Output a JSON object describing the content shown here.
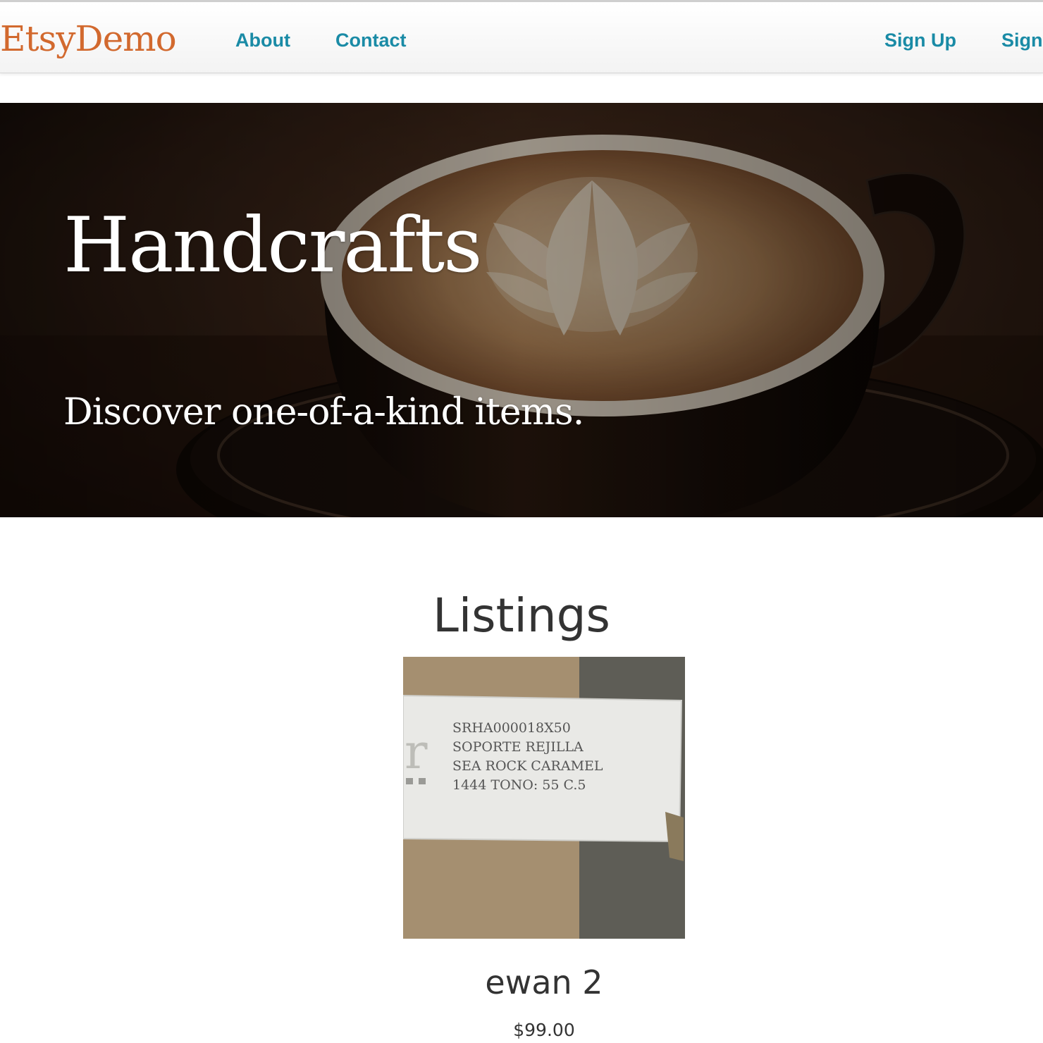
{
  "navbar": {
    "brand": "EtsyDemo",
    "links": [
      {
        "label": "About"
      },
      {
        "label": "Contact"
      }
    ],
    "right_links": [
      {
        "label": "Sign Up"
      },
      {
        "label": "Sign"
      }
    ],
    "colors": {
      "brand": "#d2692e",
      "link": "#1a8ba6"
    }
  },
  "hero": {
    "title": "Handcrafts",
    "subtitle": "Discover one-of-a-kind items.",
    "image": "coffee-latte-art-photo"
  },
  "listings": {
    "heading": "Listings",
    "items": [
      {
        "name": "ewan 2",
        "price": "$99.00",
        "image": "product-label-photo",
        "label_lines": [
          "SRHA000018X50",
          "SOPORTE REJILLA",
          "SEA ROCK CARAMEL",
          "1444 TONO: 55 C.5"
        ]
      }
    ]
  }
}
